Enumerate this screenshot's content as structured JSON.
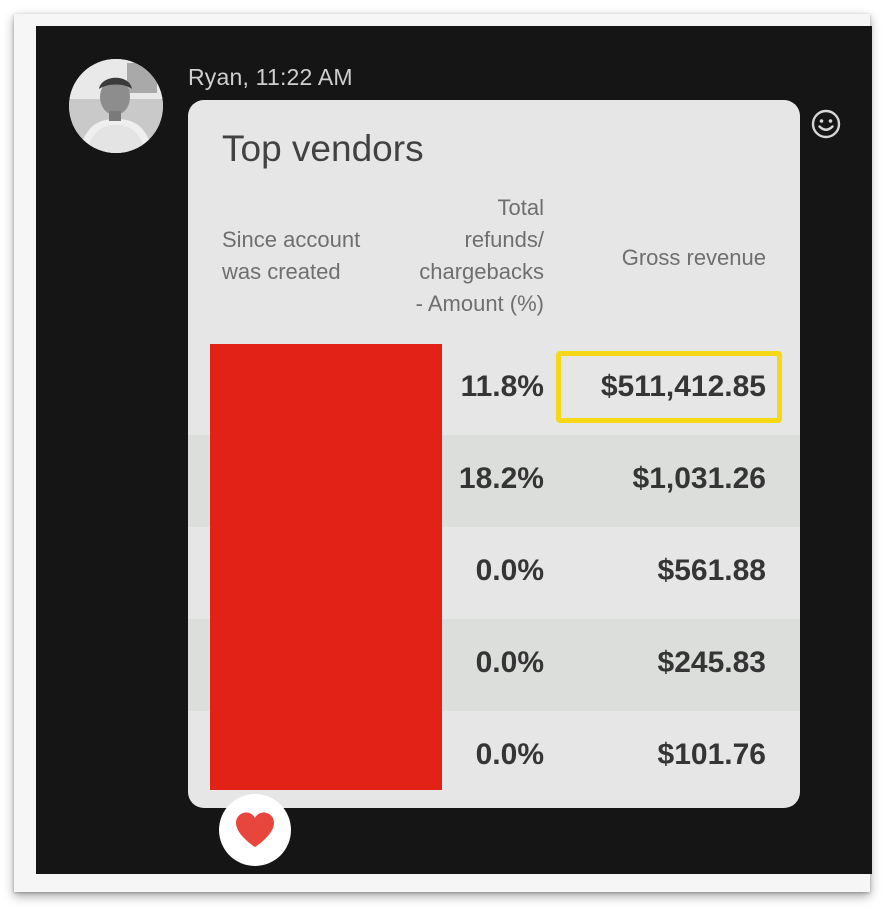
{
  "message": {
    "sender": "Ryan, 11:22 AM"
  },
  "card": {
    "title": "Top vendors",
    "headers": {
      "since": [
        "Since account",
        "was created"
      ],
      "refunds": [
        "Total",
        "refunds/",
        "chargebacks",
        "- Amount (%)"
      ],
      "gross": "Gross revenue"
    },
    "rows": [
      {
        "refund_pct": "11.8%",
        "gross_revenue": "$511,412.85"
      },
      {
        "refund_pct": "18.2%",
        "gross_revenue": "$1,031.26"
      },
      {
        "refund_pct": "0.0%",
        "gross_revenue": "$561.88"
      },
      {
        "refund_pct": "0.0%",
        "gross_revenue": "$245.83"
      },
      {
        "refund_pct": "0.0%",
        "gross_revenue": "$101.76"
      }
    ]
  },
  "icons": {
    "reaction": "heart-icon",
    "emoji": "smiley-icon"
  },
  "colors": {
    "redaction": "#e32217",
    "highlight": "#f7d816",
    "heart": "#e8453c"
  }
}
